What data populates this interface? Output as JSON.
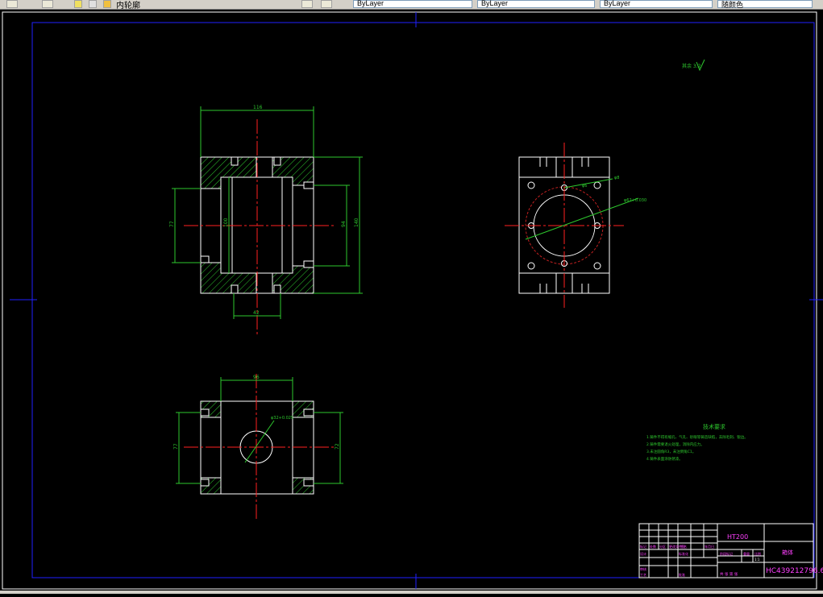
{
  "toolbar": {
    "layer_label": "内轮廓",
    "dropdowns": [
      "ByLayer",
      "ByLayer",
      "ByLayer",
      "随颜色"
    ]
  },
  "drawing": {
    "dims": {
      "top_width": "116",
      "side_height_left": "77",
      "inner_height": "100",
      "inner_height_right": "94",
      "total_height": "140",
      "bottom_width": "42",
      "view3_width": "96",
      "view3_left_height": "77",
      "view3_right_height": "72",
      "view3_bore": "φ32+0.025",
      "view2_hole": "φ6",
      "view2_bore": "φ62+0.030",
      "view2_pcd": "φ8"
    },
    "roughness_note": "其余 3.2",
    "tech_requirements": {
      "title": "技术要求",
      "lines": [
        "1.铸件不得有缩孔、气孔、砂眼等铸造缺陷，去除毛刺、锐边。",
        "2.铸件需要退火处理，消除内应力。",
        "3.未注圆角R3，未注倒角C1。",
        "4.铸件表面涂防锈漆。"
      ]
    },
    "title_block": {
      "material": "HT200",
      "part_name": "箱体",
      "code": "HC439212796.6",
      "cells": [
        "标记",
        "处数",
        "分区",
        "更改文件号",
        "签名",
        "年月日",
        "设计",
        "标准化",
        "阶段标记",
        "重量",
        "比例",
        "审核",
        "工艺",
        "批准",
        "共 张 第 张",
        "1:1"
      ]
    }
  }
}
